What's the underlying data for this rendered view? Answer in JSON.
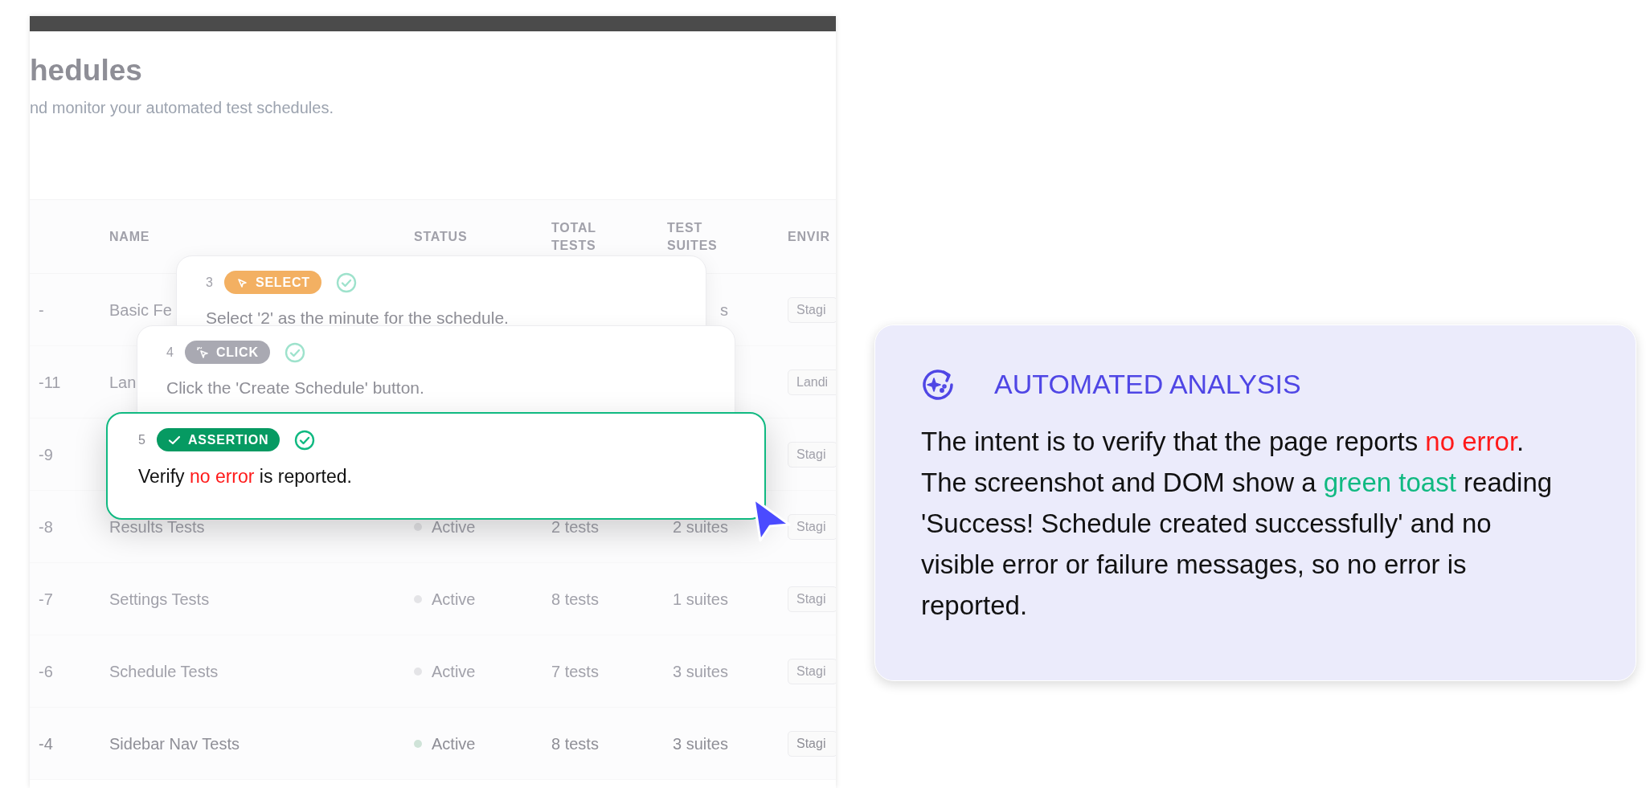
{
  "page": {
    "title": "hedules",
    "subtitle": "nd monitor your automated test schedules."
  },
  "table": {
    "columns": [
      "NAME",
      "STATUS",
      "TOTAL TESTS",
      "TEST SUITES",
      "ENVIR"
    ],
    "rows": [
      {
        "id": "-",
        "name": "Basic Fe",
        "suites": "s",
        "environment": "Stagi"
      },
      {
        "id": "-11",
        "name": "Lan",
        "environment": "Landi"
      },
      {
        "id": "-9",
        "environment": "Stagi"
      },
      {
        "id": "-8",
        "name": "Results Tests",
        "status": "Active",
        "total": "2 tests",
        "suites": "2 suites",
        "environment": "Stagi"
      },
      {
        "id": "-7",
        "name": "Settings Tests",
        "status": "Active",
        "total": "8 tests",
        "suites": "1 suites",
        "environment": "Stagi"
      },
      {
        "id": "-6",
        "name": "Schedule Tests",
        "status": "Active",
        "total": "7 tests",
        "suites": "3 suites",
        "environment": "Stagi"
      },
      {
        "id": "-4",
        "name": "Sidebar Nav Tests",
        "status": "Active",
        "total": "8 tests",
        "suites": "3 suites",
        "environment": "Stagi"
      }
    ]
  },
  "steps": [
    {
      "number": "3",
      "kind": "select",
      "badge": "SELECT",
      "selected": false,
      "parts": [
        {
          "text": "Select '2' as the minute for the schedule."
        }
      ]
    },
    {
      "number": "4",
      "kind": "click",
      "badge": "CLICK",
      "selected": false,
      "parts": [
        {
          "text": "Click the 'Create Schedule' button."
        }
      ]
    },
    {
      "number": "5",
      "kind": "assertion",
      "badge": "ASSERTION",
      "selected": true,
      "parts": [
        {
          "text": "Verify "
        },
        {
          "text": "no error",
          "color": "#ff1a1a"
        },
        {
          "text": " is reported."
        }
      ]
    }
  ],
  "analysis": {
    "title": "AUTOMATED ANALYSIS",
    "parts": [
      {
        "text": "The intent is to verify that the page reports "
      },
      {
        "text": "no error",
        "color": "#ff1a1a"
      },
      {
        "text": ". The screenshot and DOM show a "
      },
      {
        "text": "green toast",
        "color": "#10b981"
      },
      {
        "text": " reading 'Success! Schedule created successfully' and no visible error or failure messages, so no error is reported."
      }
    ]
  }
}
